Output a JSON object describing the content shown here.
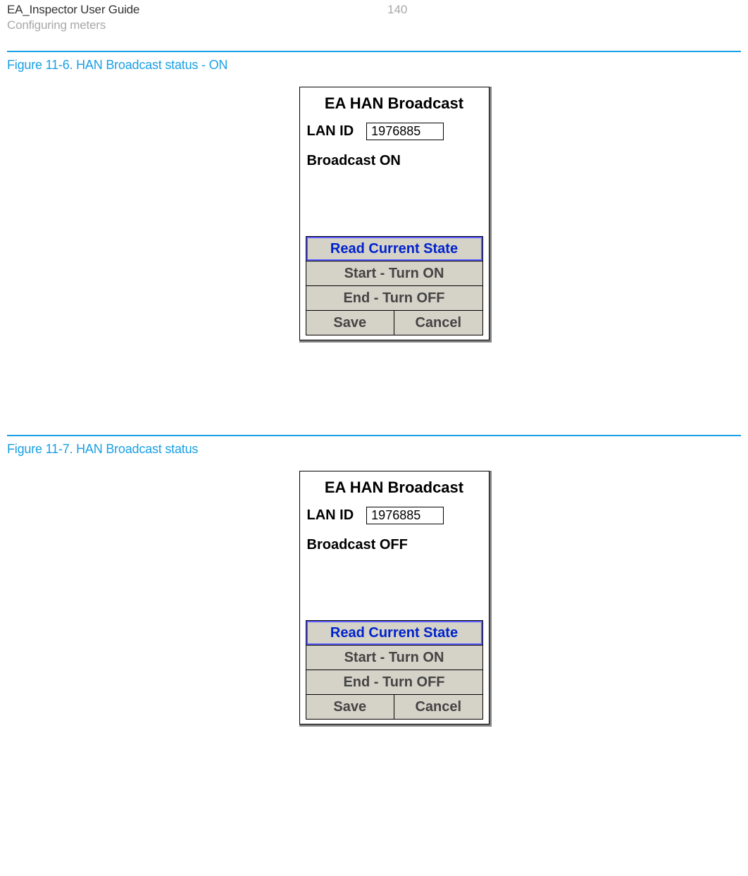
{
  "header": {
    "title": "EA_Inspector User Guide",
    "subtitle": "Configuring meters",
    "page_number": "140"
  },
  "figure1": {
    "caption": "Figure 11-6. HAN Broadcast status - ON",
    "panel": {
      "title": "EA HAN Broadcast",
      "lan_label": "LAN ID",
      "lan_value": "1976885",
      "status": "Broadcast ON",
      "buttons": {
        "read": "Read Current State",
        "start": "Start - Turn ON",
        "end": "End - Turn OFF",
        "save": "Save",
        "cancel": "Cancel"
      }
    }
  },
  "figure2": {
    "caption": "Figure 11-7. HAN Broadcast status",
    "panel": {
      "title": "EA HAN Broadcast",
      "lan_label": "LAN ID",
      "lan_value": "1976885",
      "status": "Broadcast OFF",
      "buttons": {
        "read": "Read Current State",
        "start": "Start - Turn ON",
        "end": "End - Turn OFF",
        "save": "Save",
        "cancel": "Cancel"
      }
    }
  }
}
